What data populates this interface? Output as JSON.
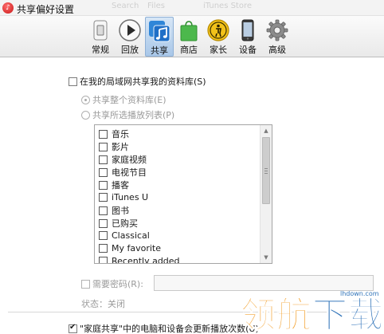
{
  "window": {
    "title": "共享偏好设置",
    "ghost_tabs": [
      "Search",
      "Files",
      "iTunes Store"
    ]
  },
  "toolbar": {
    "items": [
      {
        "label": "常规",
        "icon": "general-switch-icon"
      },
      {
        "label": "回放",
        "icon": "playback-icon"
      },
      {
        "label": "共享",
        "icon": "sharing-music-note-icon",
        "active": true
      },
      {
        "label": "商店",
        "icon": "store-bag-icon"
      },
      {
        "label": "家长",
        "icon": "parental-icon"
      },
      {
        "label": "设备",
        "icon": "device-phone-icon"
      },
      {
        "label": "高级",
        "icon": "advanced-gear-icon"
      }
    ]
  },
  "sharing": {
    "share_library_label": "在我的局域网共享我的资料库(S)",
    "share_library_checked": false,
    "share_entire_label": "共享整个资料库(E)",
    "share_selected_label": "共享所选播放列表(P)",
    "playlists": [
      "音乐",
      "影片",
      "家庭视频",
      "电视节目",
      "播客",
      "iTunes U",
      "图书",
      "已购买",
      "Classical",
      "My favorite",
      "Recently added"
    ],
    "require_password_label": "需要密码(R):",
    "password_value": "",
    "status_label": "状态：关闭",
    "home_sharing_label": "\"家庭共享\"中的电脑和设备会更新播放次数(U)",
    "home_sharing_checked": true
  },
  "watermark": {
    "logo_text": "领航下载",
    "site": "lhdown.com"
  },
  "colors": {
    "active_tab": "#a9c7e8",
    "watermark_blue": "#2e72b8",
    "watermark_orange": "#f29a1f"
  }
}
